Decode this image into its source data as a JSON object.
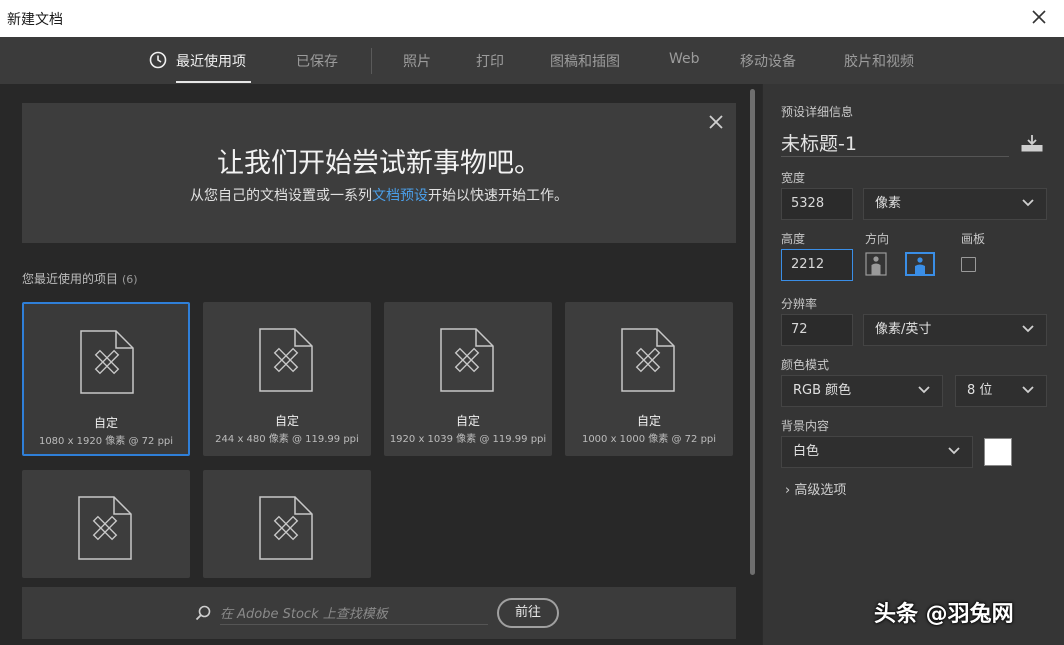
{
  "window": {
    "title": "新建文档"
  },
  "tabs": [
    {
      "label": "最近使用项",
      "active": true
    },
    {
      "label": "已保存"
    },
    {
      "label": "照片"
    },
    {
      "label": "打印"
    },
    {
      "label": "图稿和插图"
    },
    {
      "label": "Web"
    },
    {
      "label": "移动设备"
    },
    {
      "label": "胶片和视频"
    }
  ],
  "banner": {
    "headline": "让我们开始尝试新事物吧。",
    "sub_before": "从您自己的文档设置或一系列",
    "sub_link": "文档预设",
    "sub_after": "开始以快速开始工作。"
  },
  "recent": {
    "label": "您最近使用的项目",
    "count": "(6)",
    "items": [
      {
        "name": "自定",
        "meta": "1080 x 1920 像素 @ 72 ppi",
        "selected": true
      },
      {
        "name": "自定",
        "meta": "244 x 480 像素 @ 119.99 ppi"
      },
      {
        "name": "自定",
        "meta": "1920 x 1039 像素 @ 119.99 ppi"
      },
      {
        "name": "自定",
        "meta": "1000 x 1000 像素 @ 72 ppi"
      },
      {
        "name": "",
        "meta": ""
      },
      {
        "name": "",
        "meta": ""
      }
    ]
  },
  "stock": {
    "placeholder": "在 Adobe Stock 上查找模板",
    "go_label": "前往"
  },
  "preset": {
    "section_label": "预设详细信息",
    "doc_name": "未标题-1",
    "width_label": "宽度",
    "width_value": "5328",
    "width_unit": "像素",
    "height_label": "高度",
    "height_value": "2212",
    "orientation_label": "方向",
    "artboard_label": "画板",
    "resolution_label": "分辨率",
    "resolution_value": "72",
    "resolution_unit": "像素/英寸",
    "color_mode_label": "颜色模式",
    "color_mode_value": "RGB 颜色",
    "bit_depth_value": "8 位",
    "background_label": "背景内容",
    "background_value": "白色",
    "advanced_label": "高级选项"
  },
  "watermark": "头条 @羽兔网",
  "colors": {
    "accent": "#2f7fd8",
    "link": "#4a9ee8",
    "panel": "#353535",
    "canvas": "#282828"
  }
}
